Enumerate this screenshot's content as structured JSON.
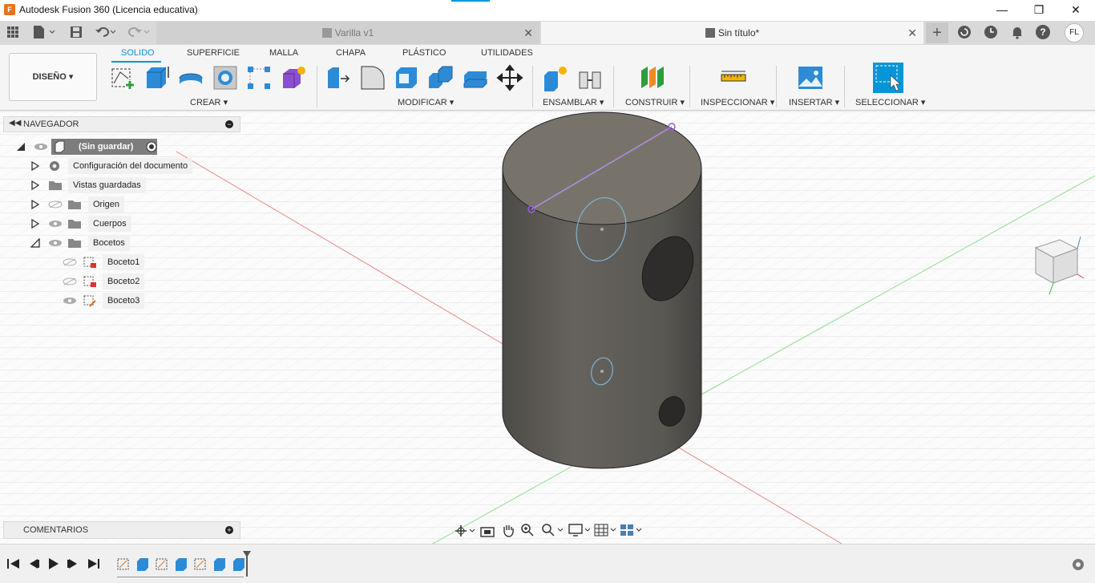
{
  "app": {
    "window_title": "Autodesk Fusion 360 (Licencia educativa)",
    "icon_letter": "F"
  },
  "tabs": [
    {
      "label": "Varilla v1",
      "active": false
    },
    {
      "label": "Sin título*",
      "active": true
    }
  ],
  "user_initials": "FL",
  "workspace": {
    "label": "DISEÑO"
  },
  "subtabs": [
    "SOLIDO",
    "SUPERFICIE",
    "MALLA",
    "CHAPA",
    "PLÁSTICO",
    "UTILIDADES"
  ],
  "tool_groups": [
    "CREAR",
    "MODIFICAR",
    "ENSAMBLAR",
    "CONSTRUIR",
    "INSPECCIONAR",
    "INSERTAR",
    "SELECCIONAR"
  ],
  "navigator": {
    "title": "NAVEGADOR",
    "root": "(Sin guardar)",
    "items": [
      {
        "label": "Configuración del documento"
      },
      {
        "label": "Vistas guardadas"
      },
      {
        "label": "Origen"
      },
      {
        "label": "Cuerpos"
      },
      {
        "label": "Bocetos"
      }
    ],
    "sketches": [
      {
        "label": "Boceto1"
      },
      {
        "label": "Boceto2"
      },
      {
        "label": "Boceto3"
      }
    ]
  },
  "comments": {
    "title": "COMENTARIOS"
  },
  "colors": {
    "accent": "#0696d7",
    "body": "#5f5c57",
    "top_face": "#77736b"
  }
}
